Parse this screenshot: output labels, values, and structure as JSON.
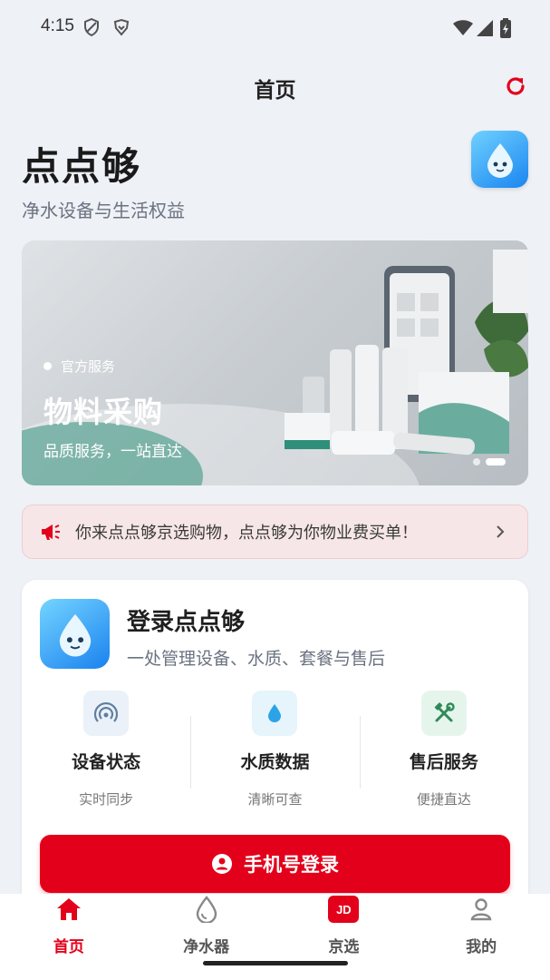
{
  "status_bar": {
    "time": "4:15"
  },
  "header": {
    "title": "首页"
  },
  "brand": {
    "name": "点点够",
    "tagline": "净水设备与生活权益"
  },
  "banner": {
    "eyebrow": "官方服务",
    "title": "物料采购",
    "subtitle": "品质服务，一站直达",
    "page_count": 2,
    "active_page": 2
  },
  "notice": {
    "text": "你来点点够京选购物，点点够为你物业费买单！"
  },
  "login_card": {
    "title": "登录点点够",
    "subtitle": "一处管理设备、水质、套餐与售后",
    "features": [
      {
        "icon": "signal-icon",
        "title": "设备状态",
        "subtitle": "实时同步"
      },
      {
        "icon": "water-drop-icon",
        "title": "水质数据",
        "subtitle": "清晰可查"
      },
      {
        "icon": "tools-icon",
        "title": "售后服务",
        "subtitle": "便捷直达"
      }
    ],
    "button_label": "手机号登录"
  },
  "bottom_nav": {
    "items": [
      {
        "label": "首页",
        "icon": "home-icon",
        "active": true
      },
      {
        "label": "净水器",
        "icon": "water-drop-icon",
        "active": false
      },
      {
        "label": "京选",
        "icon": "jd-icon",
        "badge_text": "JD",
        "active": false
      },
      {
        "label": "我的",
        "icon": "user-icon",
        "active": false
      }
    ]
  },
  "colors": {
    "accent": "#e3001b",
    "background": "#eef1f6",
    "notice_bg": "#f7e6e7"
  }
}
